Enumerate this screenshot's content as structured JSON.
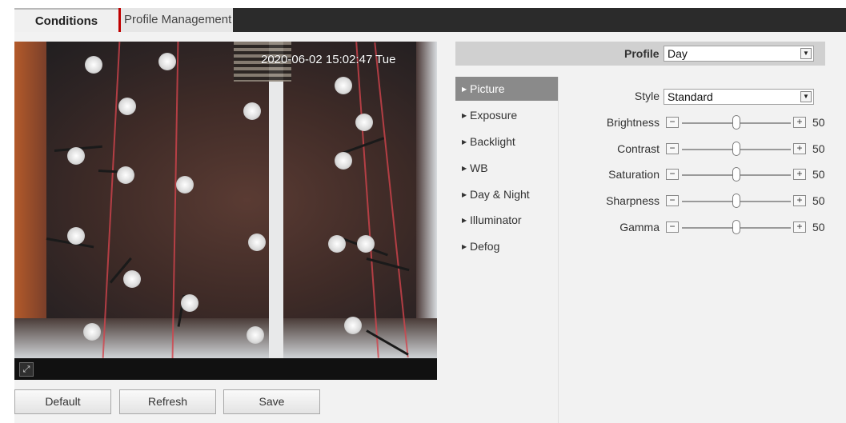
{
  "tabs": {
    "conditions": "Conditions",
    "profile_management": "Profile Management"
  },
  "video": {
    "timestamp": "2020-06-02 15:02:47 Tue"
  },
  "buttons": {
    "default": "Default",
    "refresh": "Refresh",
    "save": "Save"
  },
  "profile": {
    "label": "Profile",
    "value": "Day"
  },
  "menu": [
    "Picture",
    "Exposure",
    "Backlight",
    "WB",
    "Day & Night",
    "Illuminator",
    "Defog"
  ],
  "style": {
    "label": "Style",
    "value": "Standard"
  },
  "sliders": [
    {
      "label": "Brightness",
      "value": "50"
    },
    {
      "label": "Contrast",
      "value": "50"
    },
    {
      "label": "Saturation",
      "value": "50"
    },
    {
      "label": "Sharpness",
      "value": "50"
    },
    {
      "label": "Gamma",
      "value": "50"
    }
  ]
}
